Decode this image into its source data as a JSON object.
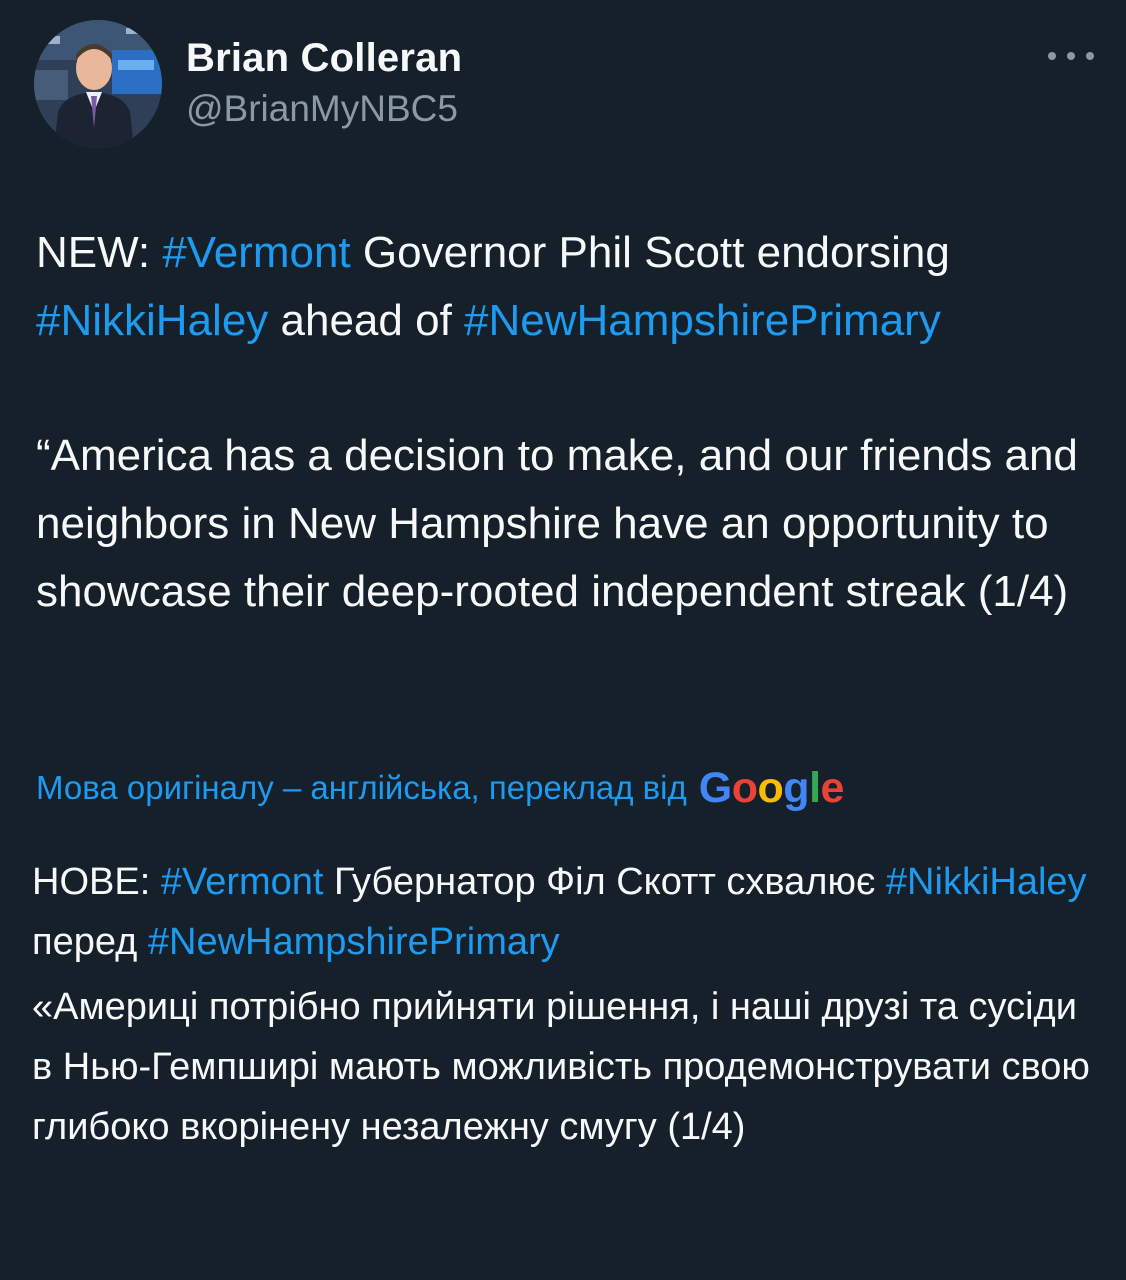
{
  "author": {
    "display_name": "Brian Colleran",
    "handle": "@BrianMyNBC5"
  },
  "icons": {
    "more": "more-horizontal-icon",
    "avatar": "profile-photo"
  },
  "tweet": {
    "original": {
      "p1": {
        "t1": "NEW: ",
        "h1": "#Vermont",
        "t2": " Governor Phil Scott endorsing ",
        "h2": "#NikkiHaley",
        "t3": " ahead of ",
        "h3": "#NewHampshirePrimary"
      },
      "p2": "“America has a decision to make, and our friends and neighbors in New Hampshire have an opportunity to showcase their deep-rooted independent streak (1/4)"
    },
    "translation_note": {
      "text": "Мова оригіналу – англійська, переклад від",
      "provider": "Google",
      "provider_letters": [
        "G",
        "o",
        "o",
        "g",
        "l",
        "e"
      ]
    },
    "translated": {
      "p1": {
        "t1": "НОВЕ: ",
        "h1": "#Vermont",
        "t2": " Губернатор Філ Скотт схвалює ",
        "h2": "#NikkiHaley",
        "t3": " перед ",
        "h3": "#NewHampshirePrimary"
      },
      "p2": "«Америці потрібно прийняти рішення, і наші друзі та сусіди в Нью-Гемпширі мають можливість продемонструвати свою глибоко вкорінену незалежну смугу (1/4)"
    }
  },
  "colors": {
    "background": "#15202b",
    "text": "#f7f9f9",
    "secondary_text": "#8b98a5",
    "link": "#1d9bf0",
    "google_blue": "#4285f4",
    "google_red": "#ea4335",
    "google_yellow": "#fbbc05",
    "google_green": "#34a853"
  }
}
